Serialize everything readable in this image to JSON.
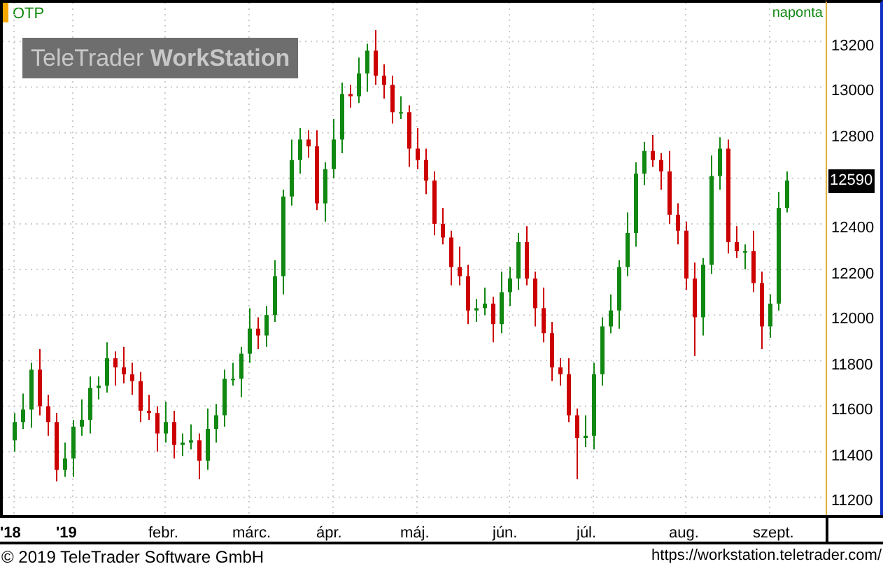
{
  "chart": {
    "symbol": "OTP",
    "interval": "naponta",
    "watermark_light": "TeleTrader",
    "watermark_bold": "WorkStation",
    "last_price": "12590",
    "chart_data": {
      "type": "candlestick",
      "grid": true,
      "ylim": [
        11110,
        13370
      ],
      "yticks": [
        13200,
        13000,
        12800,
        12400,
        12200,
        12000,
        11800,
        11600,
        11400,
        11200
      ],
      "categories": [
        "'18",
        null,
        null,
        null,
        null,
        null,
        null,
        "'19",
        null,
        null,
        null,
        null,
        null,
        null,
        null,
        null,
        null,
        null,
        "febr.",
        null,
        null,
        null,
        null,
        null,
        null,
        null,
        null,
        null,
        "márc.",
        null,
        null,
        null,
        null,
        null,
        null,
        null,
        null,
        null,
        "ápr.",
        null,
        null,
        null,
        null,
        null,
        null,
        null,
        null,
        null,
        "máj.",
        null,
        null,
        null,
        null,
        null,
        null,
        null,
        null,
        null,
        null,
        "jún.",
        null,
        null,
        null,
        null,
        null,
        null,
        null,
        null,
        null,
        "júl.",
        null,
        null,
        null,
        null,
        null,
        null,
        null,
        null,
        null,
        null,
        "aug.",
        null,
        null,
        null,
        null,
        null,
        null,
        null,
        null,
        null,
        "szept.",
        null,
        null
      ],
      "ohlc": [
        [
          11450,
          11570,
          11400,
          11530
        ],
        [
          11530,
          11655,
          11500,
          11585
        ],
        [
          11585,
          11790,
          11505,
          11760
        ],
        [
          11760,
          11850,
          11560,
          11600
        ],
        [
          11600,
          11650,
          11470,
          11530
        ],
        [
          11530,
          11570,
          11270,
          11320
        ],
        [
          11320,
          11440,
          11290,
          11370
        ],
        [
          11370,
          11540,
          11290,
          11510
        ],
        [
          11510,
          11630,
          11470,
          11540
        ],
        [
          11540,
          11730,
          11480,
          11680
        ],
        [
          11680,
          11730,
          11630,
          11690
        ],
        [
          11690,
          11880,
          11660,
          11810
        ],
        [
          11810,
          11840,
          11690,
          11770
        ],
        [
          11770,
          11860,
          11700,
          11740
        ],
        [
          11740,
          11790,
          11650,
          11710
        ],
        [
          11710,
          11750,
          11530,
          11580
        ],
        [
          11580,
          11650,
          11540,
          11570
        ],
        [
          11570,
          11600,
          11400,
          11480
        ],
        [
          11480,
          11620,
          11440,
          11530
        ],
        [
          11530,
          11580,
          11370,
          11430
        ],
        [
          11430,
          11480,
          11380,
          11440
        ],
        [
          11440,
          11520,
          11410,
          11450
        ],
        [
          11450,
          11480,
          11280,
          11360
        ],
        [
          11360,
          11590,
          11320,
          11500
        ],
        [
          11500,
          11610,
          11440,
          11560
        ],
        [
          11560,
          11760,
          11510,
          11720
        ],
        [
          11720,
          11790,
          11690,
          11720
        ],
        [
          11720,
          11860,
          11640,
          11830
        ],
        [
          11830,
          12030,
          11790,
          11940
        ],
        [
          11940,
          11990,
          11850,
          11910
        ],
        [
          11910,
          12040,
          11860,
          12000
        ],
        [
          12000,
          12240,
          11970,
          12170
        ],
        [
          12170,
          12550,
          12090,
          12520
        ],
        [
          12520,
          12770,
          12480,
          12680
        ],
        [
          12680,
          12820,
          12620,
          12770
        ],
        [
          12770,
          12810,
          12690,
          12740
        ],
        [
          12740,
          12810,
          12460,
          12490
        ],
        [
          12490,
          12670,
          12410,
          12640
        ],
        [
          12640,
          12860,
          12600,
          12770
        ],
        [
          12770,
          13020,
          12710,
          12970
        ],
        [
          12970,
          13010,
          12910,
          12960
        ],
        [
          12960,
          13130,
          12930,
          13060
        ],
        [
          13060,
          13190,
          12980,
          13160
        ],
        [
          13160,
          13250,
          13010,
          13050
        ],
        [
          13050,
          13100,
          12950,
          13010
        ],
        [
          13010,
          13050,
          12840,
          12890
        ],
        [
          12890,
          12960,
          12860,
          12890
        ],
        [
          12890,
          12920,
          12650,
          12730
        ],
        [
          12730,
          12820,
          12640,
          12680
        ],
        [
          12680,
          12730,
          12530,
          12590
        ],
        [
          12590,
          12630,
          12350,
          12400
        ],
        [
          12400,
          12470,
          12310,
          12340
        ],
        [
          12340,
          12370,
          12130,
          12210
        ],
        [
          12210,
          12300,
          12130,
          12170
        ],
        [
          12170,
          12220,
          11960,
          12020
        ],
        [
          12020,
          12070,
          11970,
          12030
        ],
        [
          12030,
          12120,
          12000,
          12050
        ],
        [
          12050,
          12080,
          11880,
          11960
        ],
        [
          11960,
          12190,
          11920,
          12100
        ],
        [
          12100,
          12210,
          12040,
          12160
        ],
        [
          12160,
          12360,
          12110,
          12320
        ],
        [
          12320,
          12390,
          12130,
          12160
        ],
        [
          12160,
          12190,
          11950,
          12030
        ],
        [
          12030,
          12120,
          11880,
          11920
        ],
        [
          11920,
          11970,
          11710,
          11770
        ],
        [
          11770,
          11810,
          11690,
          11740
        ],
        [
          11740,
          11810,
          11530,
          11560
        ],
        [
          11560,
          11590,
          11280,
          11460
        ],
        [
          11460,
          11560,
          11420,
          11470
        ],
        [
          11470,
          11790,
          11410,
          11740
        ],
        [
          11740,
          11990,
          11690,
          11950
        ],
        [
          11950,
          12090,
          11920,
          12020
        ],
        [
          12020,
          12240,
          11940,
          12210
        ],
        [
          12210,
          12450,
          12170,
          12360
        ],
        [
          12360,
          12670,
          12300,
          12620
        ],
        [
          12620,
          12760,
          12570,
          12720
        ],
        [
          12720,
          12790,
          12650,
          12680
        ],
        [
          12680,
          12710,
          12550,
          12630
        ],
        [
          12630,
          12720,
          12400,
          12440
        ],
        [
          12440,
          12490,
          12310,
          12370
        ],
        [
          12370,
          12410,
          12110,
          12160
        ],
        [
          12160,
          12230,
          11820,
          11990
        ],
        [
          11990,
          12250,
          11910,
          12220
        ],
        [
          12220,
          12700,
          12180,
          12610
        ],
        [
          12610,
          12780,
          12550,
          12730
        ],
        [
          12730,
          12770,
          12270,
          12320
        ],
        [
          12320,
          12390,
          12250,
          12280
        ],
        [
          12280,
          12310,
          12200,
          12280
        ],
        [
          12280,
          12370,
          12100,
          12140
        ],
        [
          12140,
          12190,
          11850,
          11950
        ],
        [
          11950,
          12090,
          11900,
          12050
        ],
        [
          12050,
          12540,
          12020,
          12470
        ],
        [
          12470,
          12630,
          12450,
          12590
        ]
      ]
    },
    "x_label_bold": [
      true,
      true,
      false,
      false,
      false,
      false,
      false,
      false,
      false,
      false
    ]
  },
  "footer": {
    "copyright": "© 2019 TeleTrader Software GmbH",
    "url": "https://workstation.teletrader.com/"
  }
}
